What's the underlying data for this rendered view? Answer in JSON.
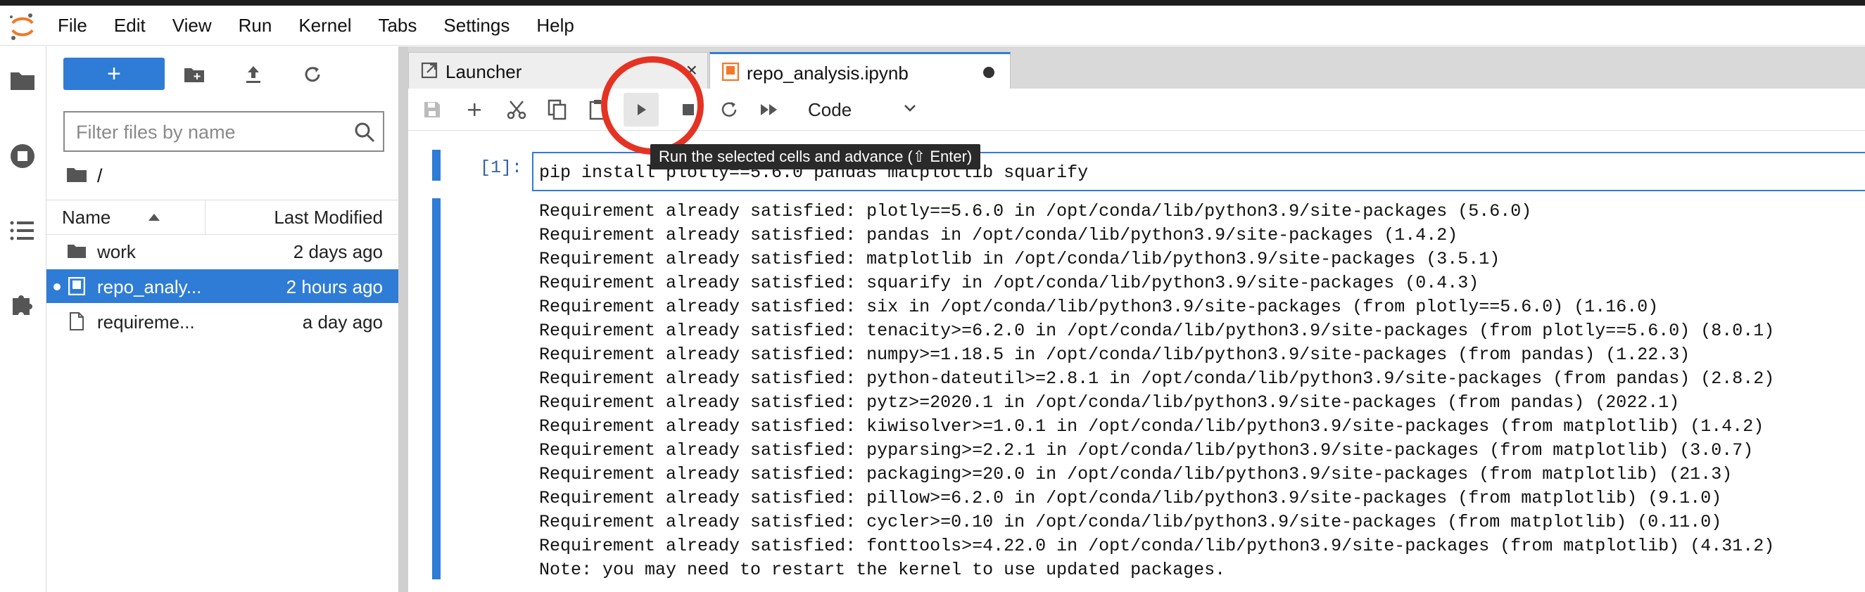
{
  "menubar": {
    "items": [
      "File",
      "Edit",
      "View",
      "Run",
      "Kernel",
      "Tabs",
      "Settings",
      "Help"
    ]
  },
  "activitybar": {
    "icons": [
      "folder-icon",
      "running-icon",
      "toc-icon",
      "extension-icon"
    ]
  },
  "filebrowser": {
    "new_button_label": "+",
    "filter_placeholder": "Filter files by name",
    "breadcrumb": "/",
    "columns": {
      "name": "Name",
      "modified": "Last Modified"
    },
    "files": [
      {
        "name": "work",
        "modified": "2 days ago",
        "type": "folder",
        "selected": false
      },
      {
        "name": "repo_analy...",
        "modified": "2 hours ago",
        "type": "notebook",
        "selected": true
      },
      {
        "name": "requireme...",
        "modified": "a day ago",
        "type": "file",
        "selected": false
      }
    ]
  },
  "tabs": [
    {
      "label": "Launcher",
      "active": false
    },
    {
      "label": "repo_analysis.ipynb",
      "active": true
    }
  ],
  "toolbar": {
    "cell_type": "Code",
    "tooltip": "Run the selected cells and advance (⇧ Enter)"
  },
  "cell": {
    "prompt": "[1]:",
    "input": "pip install plotly==5.6.0 pandas matplotlib squarify",
    "output": [
      "Requirement already satisfied: plotly==5.6.0 in /opt/conda/lib/python3.9/site-packages (5.6.0)",
      "Requirement already satisfied: pandas in /opt/conda/lib/python3.9/site-packages (1.4.2)",
      "Requirement already satisfied: matplotlib in /opt/conda/lib/python3.9/site-packages (3.5.1)",
      "Requirement already satisfied: squarify in /opt/conda/lib/python3.9/site-packages (0.4.3)",
      "Requirement already satisfied: six in /opt/conda/lib/python3.9/site-packages (from plotly==5.6.0) (1.16.0)",
      "Requirement already satisfied: tenacity>=6.2.0 in /opt/conda/lib/python3.9/site-packages (from plotly==5.6.0) (8.0.1)",
      "Requirement already satisfied: numpy>=1.18.5 in /opt/conda/lib/python3.9/site-packages (from pandas) (1.22.3)",
      "Requirement already satisfied: python-dateutil>=2.8.1 in /opt/conda/lib/python3.9/site-packages (from pandas) (2.8.2)",
      "Requirement already satisfied: pytz>=2020.1 in /opt/conda/lib/python3.9/site-packages (from pandas) (2022.1)",
      "Requirement already satisfied: kiwisolver>=1.0.1 in /opt/conda/lib/python3.9/site-packages (from matplotlib) (1.4.2)",
      "Requirement already satisfied: pyparsing>=2.2.1 in /opt/conda/lib/python3.9/site-packages (from matplotlib) (3.0.7)",
      "Requirement already satisfied: packaging>=20.0 in /opt/conda/lib/python3.9/site-packages (from matplotlib) (21.3)",
      "Requirement already satisfied: pillow>=6.2.0 in /opt/conda/lib/python3.9/site-packages (from matplotlib) (9.1.0)",
      "Requirement already satisfied: cycler>=0.10 in /opt/conda/lib/python3.9/site-packages (from matplotlib) (0.11.0)",
      "Requirement already satisfied: fonttools>=4.22.0 in /opt/conda/lib/python3.9/site-packages (from matplotlib) (4.31.2)",
      "Note: you may need to restart the kernel to use updated packages."
    ]
  },
  "colors": {
    "accent": "#2f7cd6",
    "highlight_ring": "#e53323",
    "logo": "#f37726"
  }
}
